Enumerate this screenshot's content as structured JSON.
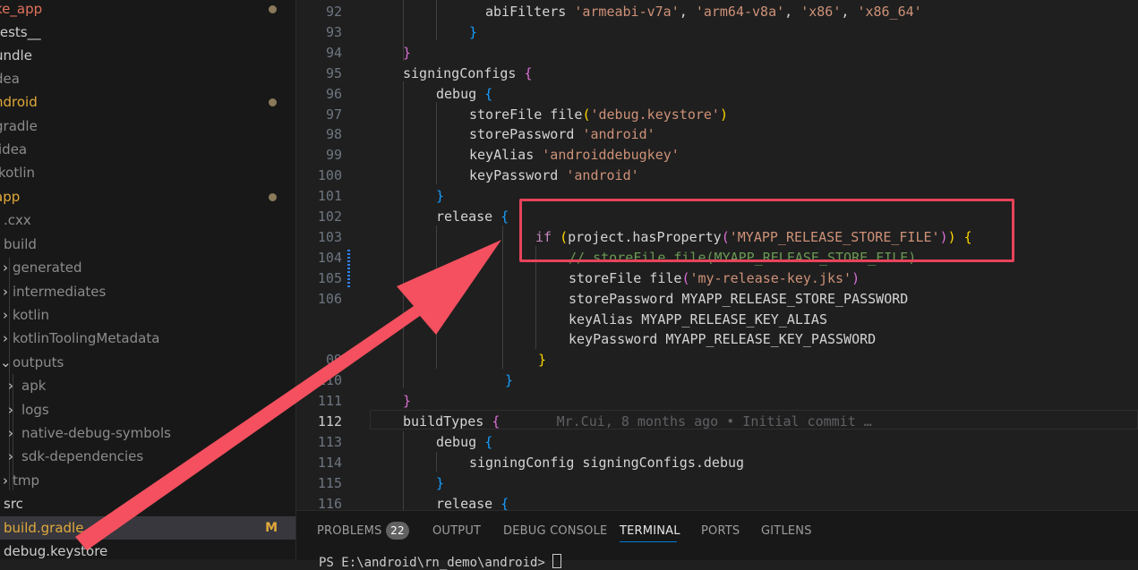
{
  "explorer": {
    "items": [
      {
        "label": "ke_app",
        "color": "#e2725b",
        "badge": "dot"
      },
      {
        "label": "tests__",
        "color": "#cccccc"
      },
      {
        "label": "undle",
        "color": "#cccccc"
      },
      {
        "label": "dea",
        "color": "#8c8c8c"
      },
      {
        "label": "ndroid",
        "color": "#e2a93b",
        "badge": "dot"
      },
      {
        "label": "gradle",
        "color": "#8c8c8c"
      },
      {
        "label": "idea",
        "color": "#8c8c8c"
      },
      {
        "label": "kotlin",
        "color": "#8c8c8c"
      },
      {
        "label": "app",
        "color": "#e2a93b",
        "badge": "dot"
      },
      {
        "label": ".cxx",
        "color": "#8c8c8c"
      },
      {
        "label": "build",
        "color": "#8c8c8c"
      },
      {
        "label": "generated",
        "color": "#8c8c8c"
      },
      {
        "label": "intermediates",
        "color": "#8c8c8c"
      },
      {
        "label": "kotlin",
        "color": "#8c8c8c"
      },
      {
        "label": "kotlinToolingMetadata",
        "color": "#8c8c8c"
      },
      {
        "label": "outputs",
        "color": "#8c8c8c"
      },
      {
        "label": "apk",
        "color": "#8c8c8c"
      },
      {
        "label": "logs",
        "color": "#8c8c8c"
      },
      {
        "label": "native-debug-symbols",
        "color": "#8c8c8c"
      },
      {
        "label": "sdk-dependencies",
        "color": "#8c8c8c"
      },
      {
        "label": "tmp",
        "color": "#8c8c8c"
      },
      {
        "label": "src",
        "color": "#cccccc"
      },
      {
        "label": "build.gradle",
        "color": "#e2a93b",
        "badge": "M"
      },
      {
        "label": "debug.keystore",
        "color": "#cccccc"
      }
    ]
  },
  "editor": {
    "current_line": "112",
    "lines": [
      {
        "n": "92",
        "t": [
          [
            "plain",
            "abiFilters "
          ],
          [
            "str",
            "'armeabi-v7a'"
          ],
          [
            "plain",
            ", "
          ],
          [
            "str",
            "'arm64-v8a'"
          ],
          [
            "plain",
            ", "
          ],
          [
            "str",
            "'x86'"
          ],
          [
            "plain",
            ", "
          ],
          [
            "str",
            "'x86_64'"
          ]
        ]
      },
      {
        "n": "93",
        "t": [
          [
            "br3",
            "}"
          ]
        ]
      },
      {
        "n": "94",
        "t": [
          [
            "br2",
            "}"
          ]
        ]
      },
      {
        "n": "95",
        "t": [
          [
            "plain",
            "signingConfigs "
          ],
          [
            "br2",
            "{"
          ]
        ]
      },
      {
        "n": "96",
        "t": [
          [
            "plain",
            "debug "
          ],
          [
            "br3",
            "{"
          ]
        ]
      },
      {
        "n": "97",
        "t": [
          [
            "plain",
            "storeFile file"
          ],
          [
            "br1",
            "("
          ],
          [
            "str",
            "'debug.keystore'"
          ],
          [
            "br1",
            ")"
          ]
        ]
      },
      {
        "n": "98",
        "t": [
          [
            "plain",
            "storePassword "
          ],
          [
            "str",
            "'android'"
          ]
        ]
      },
      {
        "n": "99",
        "t": [
          [
            "plain",
            "keyAlias "
          ],
          [
            "str",
            "'androiddebugkey'"
          ]
        ]
      },
      {
        "n": "100",
        "t": [
          [
            "plain",
            "keyPassword "
          ],
          [
            "str",
            "'android'"
          ]
        ]
      },
      {
        "n": "101",
        "t": [
          [
            "br3",
            "}"
          ]
        ]
      },
      {
        "n": "102",
        "t": [
          [
            "plain",
            "release "
          ],
          [
            "br3",
            "{"
          ]
        ]
      },
      {
        "n": "103",
        "t": [
          [
            "kw",
            "if "
          ],
          [
            "br1",
            "("
          ],
          [
            "plain",
            "project.hasProperty"
          ],
          [
            "br2",
            "("
          ],
          [
            "str",
            "'MYAPP_RELEASE_STORE_FILE'"
          ],
          [
            "br2",
            ")"
          ],
          [
            "br1",
            ")"
          ],
          [
            "plain",
            " "
          ],
          [
            "br1",
            "{"
          ]
        ]
      },
      {
        "n": "104",
        "t": [
          [
            "cmt",
            "// storeFile file(MYAPP_RELEASE_STORE_FILE)"
          ]
        ]
      },
      {
        "n": "105",
        "t": [
          [
            "plain",
            "storeFile file"
          ],
          [
            "br2",
            "("
          ],
          [
            "str",
            "'my-release-key.jks'"
          ],
          [
            "br2",
            ")"
          ]
        ]
      },
      {
        "n": "106",
        "t": [
          [
            "plain",
            "storePassword MYAPP_RELEASE_STORE_PASSWORD"
          ]
        ]
      },
      {
        "n": "",
        "t": [
          [
            "plain",
            "keyAlias MYAPP_RELEASE_KEY_ALIAS"
          ]
        ]
      },
      {
        "n": "",
        "t": [
          [
            "plain",
            "keyPassword MYAPP_RELEASE_KEY_PASSWORD"
          ]
        ]
      },
      {
        "n": "09",
        "t": [
          [
            "br1",
            "}"
          ]
        ]
      },
      {
        "n": "110",
        "t": [
          [
            "br3",
            "}"
          ]
        ]
      },
      {
        "n": "111",
        "t": [
          [
            "br2",
            "}"
          ]
        ]
      },
      {
        "n": "112",
        "t": [
          [
            "plain",
            "buildTypes "
          ],
          [
            "br2",
            "{"
          ],
          [
            "blame",
            "       Mr.Cui, 8 months ago • Initial commit …"
          ]
        ]
      },
      {
        "n": "113",
        "t": [
          [
            "plain",
            "debug "
          ],
          [
            "br3",
            "{"
          ]
        ]
      },
      {
        "n": "114",
        "t": [
          [
            "plain",
            "signingConfig signingConfigs.debug"
          ]
        ]
      },
      {
        "n": "115",
        "t": [
          [
            "br3",
            "}"
          ]
        ]
      },
      {
        "n": "116",
        "t": [
          [
            "plain",
            "release "
          ],
          [
            "br3",
            "{"
          ]
        ]
      }
    ]
  },
  "panel": {
    "tabs": [
      {
        "label": "PROBLEMS",
        "count": "22"
      },
      {
        "label": "OUTPUT"
      },
      {
        "label": "DEBUG CONSOLE"
      },
      {
        "label": "TERMINAL",
        "active": true
      },
      {
        "label": "PORTS"
      },
      {
        "label": "GITLENS"
      }
    ],
    "terminal_line": "PS E:\\android\\rn_demo\\android>"
  },
  "colors": {
    "highlight_box": "#e8435a",
    "arrow": "#f4505f",
    "active_tab_underline": "#0078d4"
  }
}
